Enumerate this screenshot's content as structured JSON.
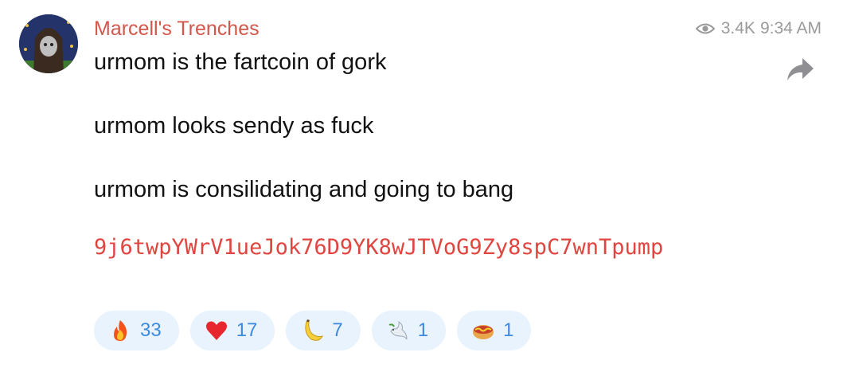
{
  "post": {
    "channel_name": "Marcell's Trenches",
    "views": "3.4K",
    "time": "9:34 AM",
    "lines": [
      "urmom is the fartcoin of gork",
      "urmom looks sendy as fuck",
      "urmom is consilidating and going to bang"
    ],
    "contract_address": "9j6twpYWrV1ueJok76D9YK8wJTVoG9Zy8spC7wnTpump"
  },
  "reactions": [
    {
      "icon": "fire-icon",
      "count": "33"
    },
    {
      "icon": "heart-icon",
      "count": "17"
    },
    {
      "icon": "banana-icon",
      "count": "7"
    },
    {
      "icon": "dove-icon",
      "count": "1"
    },
    {
      "icon": "hotdog-icon",
      "count": "1"
    }
  ],
  "colors": {
    "channel_name": "#d4564a",
    "contract_address": "#e0453f",
    "reaction_bg": "#e9f3fd",
    "reaction_count": "#3c8ae0",
    "meta": "#9a9a9a"
  }
}
